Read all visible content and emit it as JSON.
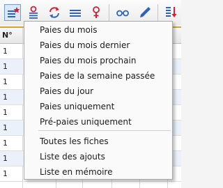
{
  "table": {
    "column_header": "N°",
    "rows": [
      "1",
      "1",
      "1",
      "1",
      "1",
      "1",
      "1",
      "1",
      "1"
    ]
  },
  "toolbar": {
    "buttons": [
      {
        "icon": "list-star-icon"
      },
      {
        "icon": "user-filter-icon"
      },
      {
        "icon": "refresh-icon"
      },
      {
        "icon": "lines-icon"
      },
      {
        "icon": "female-symbol-icon"
      },
      {
        "icon": "glasses-icon"
      },
      {
        "icon": "pen-icon"
      },
      {
        "icon": "sort-icon"
      }
    ]
  },
  "menu": {
    "items": [
      "Paies du mois",
      "Paies du mois dernier",
      "Paies du mois prochain",
      "Paies de la semaine passée",
      "Paies du jour",
      "Paies uniquement",
      "Pré-paies uniquement",
      "Toutes les fiches",
      "Liste des ajouts",
      "Liste en mémoire"
    ]
  },
  "colors": {
    "accent": "#e0a020",
    "selection": "#dbe9f7",
    "icon_blue": "#2f63b8",
    "icon_red": "#d0203a"
  }
}
